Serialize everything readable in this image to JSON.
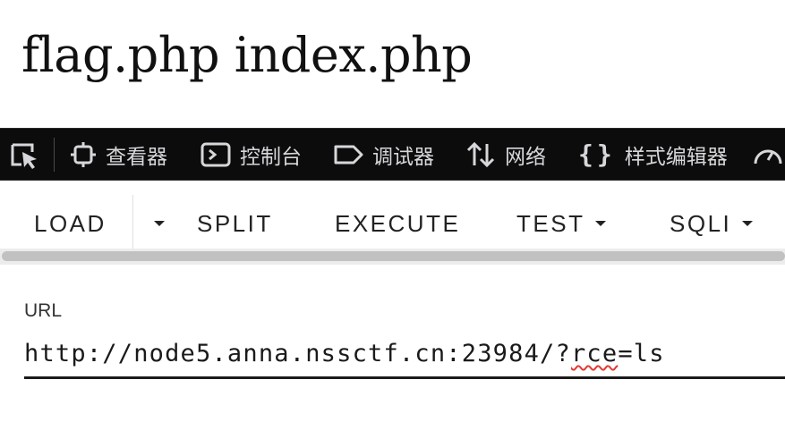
{
  "page_output": {
    "text": "flag.php index.php"
  },
  "devtools": {
    "tabs": [
      {
        "label": "查看器",
        "icon": "inspector-icon"
      },
      {
        "label": "控制台",
        "icon": "console-icon"
      },
      {
        "label": "调试器",
        "icon": "debugger-icon"
      },
      {
        "label": "网络",
        "icon": "network-icon"
      },
      {
        "label": "样式编辑器",
        "icon": "style-editor-icon"
      }
    ],
    "picker_icon": "element-picker-icon",
    "performance_icon": "performance-icon"
  },
  "hackbar": {
    "load": "LOAD",
    "split": "SPLIT",
    "execute": "EXECUTE",
    "test": "TEST",
    "sqli": "SQLI"
  },
  "url_field": {
    "label": "URL",
    "value_prefix": "http://node5.anna.nssctf.cn:23984/?",
    "value_spell": "rce",
    "value_suffix": "=ls"
  },
  "colors": {
    "devtools_bg": "#0c0c0d",
    "devtools_text": "#d7d7db",
    "spellcheck": "#e53935"
  }
}
